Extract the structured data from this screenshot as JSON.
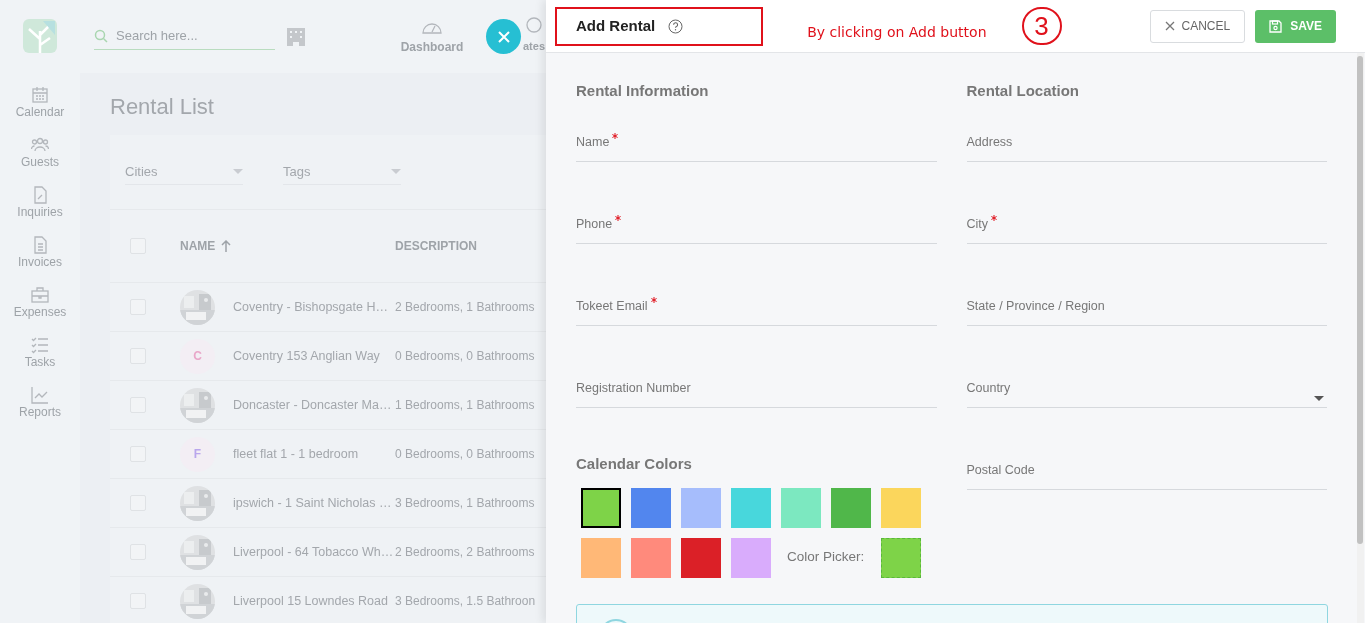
{
  "sidebar": {
    "items": [
      {
        "label": "Calendar"
      },
      {
        "label": "Guests"
      },
      {
        "label": "Inquiries"
      },
      {
        "label": "Invoices"
      },
      {
        "label": "Expenses"
      },
      {
        "label": "Tasks"
      },
      {
        "label": "Reports"
      }
    ]
  },
  "search": {
    "placeholder": "Search here..."
  },
  "top_nav": [
    {
      "label": "Dashboard"
    },
    {
      "label": "ates"
    }
  ],
  "page_title": "Rental List",
  "filters": [
    {
      "placeholder": "Cities"
    },
    {
      "placeholder": "Tags"
    }
  ],
  "table": {
    "header_checked": false,
    "columns": [
      "NAME",
      "DESCRIPTION"
    ],
    "rows": [
      {
        "checked": false,
        "name": "Coventry - Bishopsgate H…",
        "description": "2 Bedrooms, 1 Bathrooms"
      },
      {
        "checked": false,
        "avatar": {
          "kind": "letter",
          "letter": "C",
          "color": "#e9a7c9"
        },
        "name": "Coventry 153 Anglian Way",
        "description": "0 Bedrooms, 0 Bathrooms"
      },
      {
        "checked": false,
        "name": "Doncaster - Doncaster Ma…",
        "description": "1 Bedrooms, 1 Bathrooms"
      },
      {
        "checked": false,
        "avatar": {
          "kind": "letter",
          "letter": "F",
          "color": "#b9a6ec"
        },
        "name": "fleet flat 1 - 1 bedroom",
        "description": "0 Bedrooms, 0 Bathrooms"
      },
      {
        "checked": false,
        "name": "ipswich - 1 Saint Nicholas …",
        "description": "3 Bedrooms, 1 Bathrooms"
      },
      {
        "checked": false,
        "name": "Liverpool - 64 Tobacco Wh…",
        "description": "2 Bedrooms, 2 Bathrooms"
      },
      {
        "checked": false,
        "name": "Liverpool 15 Lowndes Road",
        "description": "3 Bedrooms, 1.5 Bathroon"
      }
    ]
  },
  "panel": {
    "title": "Add Rental",
    "buttons": [
      {
        "label": "CANCEL",
        "kind": "secondary"
      },
      {
        "label": "SAVE",
        "kind": "primary"
      }
    ],
    "sections": [
      {
        "title": "Rental Information",
        "fields": [
          {
            "label": "Name",
            "required": true,
            "kind": "text"
          },
          {
            "label": "Phone",
            "required": true,
            "kind": "text"
          },
          {
            "label": "Tokeet Email",
            "required": true,
            "kind": "text"
          },
          {
            "label": "Registration Number",
            "required": false,
            "kind": "text"
          }
        ]
      },
      {
        "title": "Rental Location",
        "fields": [
          {
            "label": "Address",
            "required": false,
            "kind": "text"
          },
          {
            "label": "City",
            "required": true,
            "kind": "text"
          },
          {
            "label": "State / Province / Region",
            "required": false,
            "kind": "text"
          },
          {
            "label": "Country",
            "required": false,
            "kind": "select"
          },
          {
            "label": "Postal Code",
            "required": false,
            "kind": "text"
          }
        ]
      }
    ],
    "calendar_colors": {
      "title": "Calendar Colors",
      "swatches": [
        {
          "color": "#7ed348",
          "selected": true
        },
        {
          "color": "#5286ee",
          "selected": false
        },
        {
          "color": "#a6bdfc",
          "selected": false
        },
        {
          "color": "#48d7dc",
          "selected": false
        },
        {
          "color": "#7ce8c0",
          "selected": false
        },
        {
          "color": "#50b74a",
          "selected": false
        },
        {
          "color": "#fbd65c",
          "selected": false
        },
        {
          "color": "#ffb877",
          "selected": false
        },
        {
          "color": "#ff8a7c",
          "selected": false
        },
        {
          "color": "#db2027",
          "selected": false
        },
        {
          "color": "#d9acfc",
          "selected": false
        }
      ],
      "picker_label": "Color Picker:",
      "picker": {
        "color": "#7ed348"
      }
    }
  },
  "annotation": {
    "text": "By clicking on Add button",
    "step": "3"
  }
}
